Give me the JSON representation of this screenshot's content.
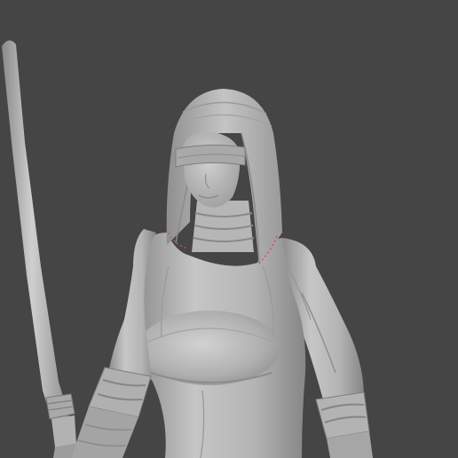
{
  "viewport": {
    "background": "#454545",
    "model_color": "#b9b9b9",
    "model_shadow": "#7d7d7d",
    "model_highlight": "#d6d6d6",
    "seam_highlight": "#d24c6a"
  },
  "scene": {
    "object": "sculpted-figure",
    "items": [
      "staff",
      "hood",
      "blindfold",
      "face",
      "neck-wrap",
      "tunic",
      "left-sleeve",
      "right-sleeve",
      "left-bracer",
      "right-bracer"
    ]
  }
}
